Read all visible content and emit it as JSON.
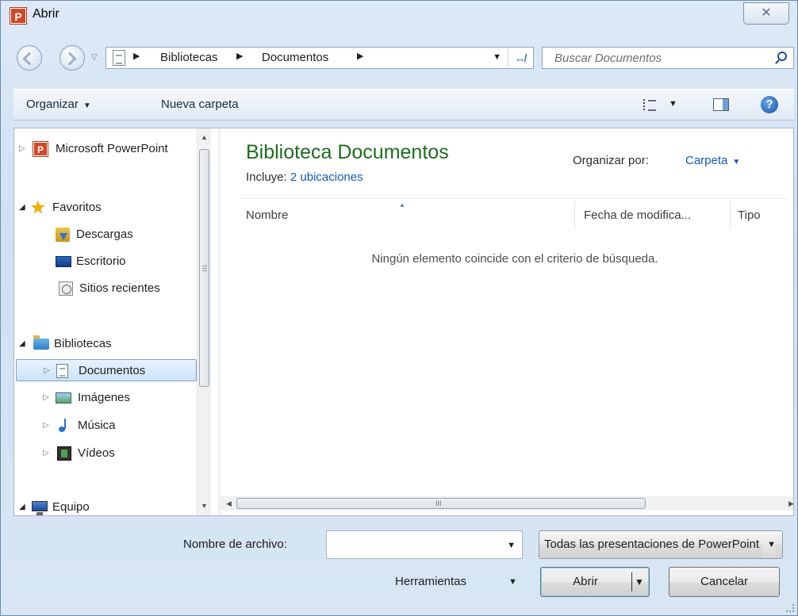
{
  "window": {
    "title": "Abrir",
    "app_icon_letter": "P",
    "close_glyph": "✕"
  },
  "address_bar": {
    "crumbs": [
      "Bibliotecas",
      "Documentos"
    ],
    "search_placeholder": "Buscar Documentos"
  },
  "toolbar": {
    "organize_label": "Organizar",
    "new_folder_label": "Nueva carpeta",
    "help_glyph": "?"
  },
  "nav_pane": {
    "items": [
      {
        "label": "Microsoft PowerPoint",
        "icon": "powerpoint-icon"
      },
      {
        "label": "Favoritos",
        "icon": "star-icon"
      },
      {
        "label": "Descargas",
        "icon": "downloads-icon"
      },
      {
        "label": "Escritorio",
        "icon": "desktop-icon"
      },
      {
        "label": "Sitios recientes",
        "icon": "recent-places-icon"
      },
      {
        "label": "Bibliotecas",
        "icon": "libraries-icon"
      },
      {
        "label": "Documentos",
        "icon": "documents-icon",
        "selected": true
      },
      {
        "label": "Imágenes",
        "icon": "pictures-icon"
      },
      {
        "label": "Música",
        "icon": "music-icon"
      },
      {
        "label": "Vídeos",
        "icon": "videos-icon"
      },
      {
        "label": "Equipo",
        "icon": "computer-icon"
      }
    ]
  },
  "file_pane": {
    "library_title": "Biblioteca Documentos",
    "includes_label": "Incluye:",
    "includes_link": "2 ubicaciones",
    "arrange_label": "Organizar por:",
    "arrange_value": "Carpeta",
    "columns": [
      "Nombre",
      "Fecha de modifica...",
      "Tipo"
    ],
    "empty_message": "Ningún elemento coincide con el criterio de búsqueda.",
    "scroll_grip": "III"
  },
  "bottom": {
    "filename_label": "Nombre de archivo:",
    "filename_value": "",
    "filter_value": "Todas las presentaciones de PowerPoint",
    "tools_label": "Herramientas",
    "open_label": "Abrir",
    "cancel_label": "Cancelar"
  },
  "colors": {
    "library_title": "#1e6e1e",
    "link": "#1657c2",
    "powerpoint": "#d24726"
  }
}
